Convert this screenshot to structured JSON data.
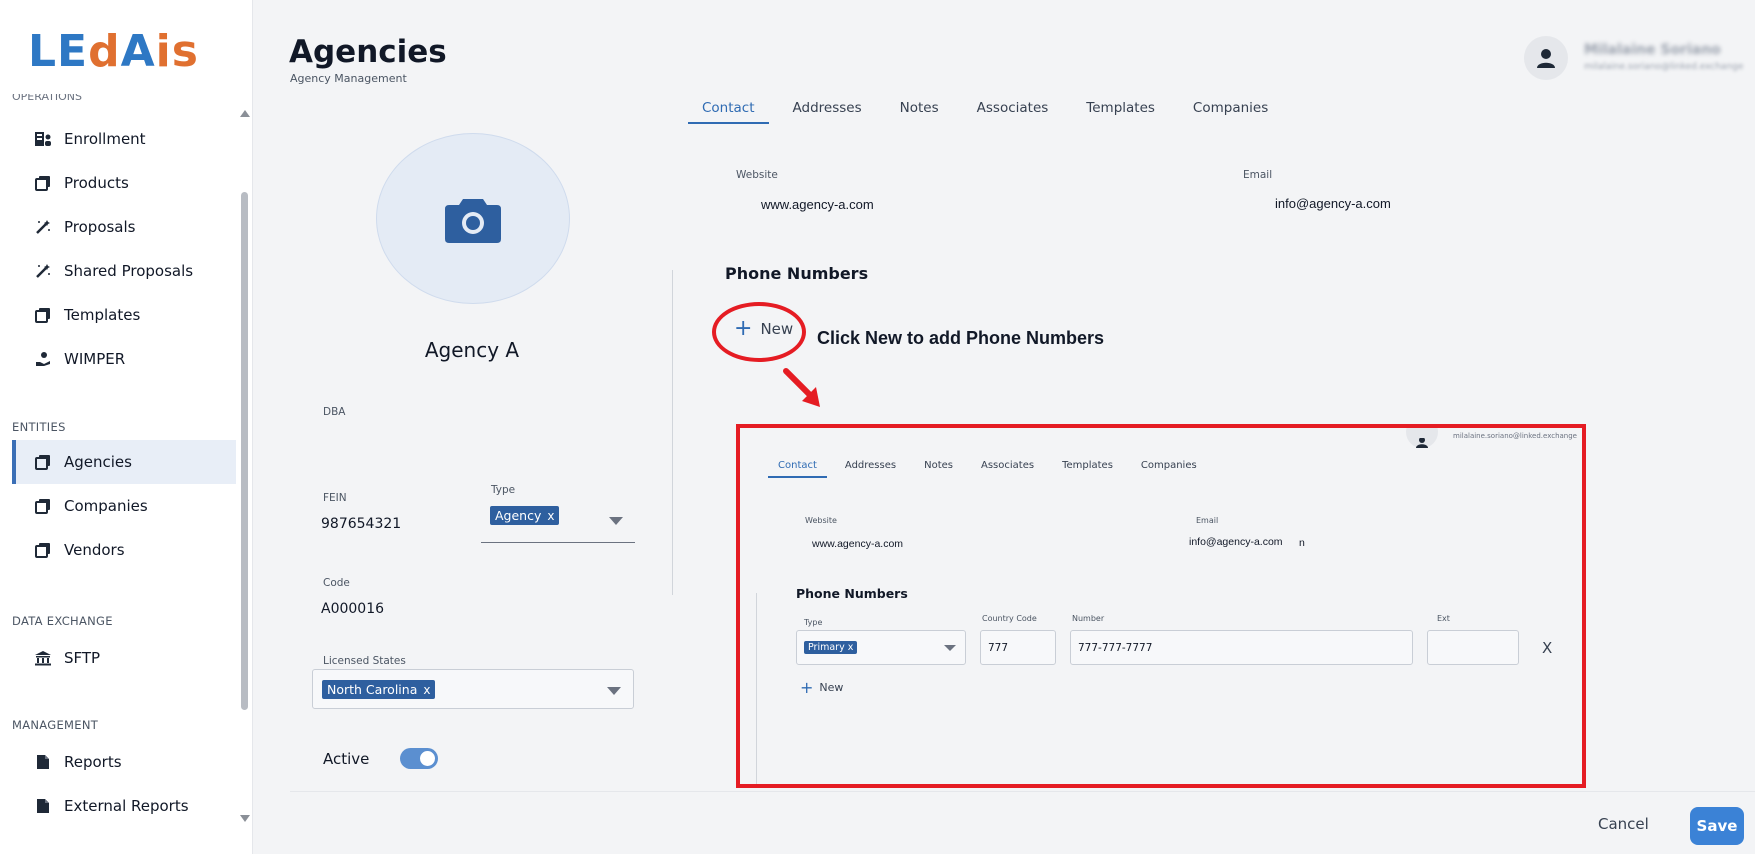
{
  "app": {
    "logo": "LEdAis"
  },
  "sidebar": {
    "cut_section": "OPERATIONS",
    "items": [
      {
        "label": "Enrollment",
        "icon": "enrollment-icon"
      },
      {
        "label": "Products",
        "icon": "stack-icon"
      },
      {
        "label": "Proposals",
        "icon": "magic-wand-icon"
      },
      {
        "label": "Shared Proposals",
        "icon": "magic-wand-icon"
      },
      {
        "label": "Templates",
        "icon": "stack-icon"
      },
      {
        "label": "WIMPER",
        "icon": "hand-coin-icon"
      }
    ],
    "entities_label": "ENTITIES",
    "entities": [
      {
        "label": "Agencies",
        "icon": "stack-icon",
        "active": true
      },
      {
        "label": "Companies",
        "icon": "stack-icon"
      },
      {
        "label": "Vendors",
        "icon": "stack-icon"
      }
    ],
    "data_exchange_label": "DATA EXCHANGE",
    "data_exchange": [
      {
        "label": "SFTP",
        "icon": "bank-icon"
      }
    ],
    "management_label": "MANAGEMENT",
    "management": [
      {
        "label": "Reports",
        "icon": "document-icon"
      },
      {
        "label": "External Reports",
        "icon": "document-icon"
      }
    ]
  },
  "header": {
    "title": "Agencies",
    "subtitle": "Agency Management",
    "user_name": "Milalaine Soriano",
    "user_email": "milalaine.soriano@linked.exchange"
  },
  "tabs": [
    "Contact",
    "Addresses",
    "Notes",
    "Associates",
    "Templates",
    "Companies"
  ],
  "active_tab": "Contact",
  "form": {
    "agency_name": "Agency A",
    "dba_label": "DBA",
    "dba_value": "",
    "fein_label": "FEIN",
    "fein_value": "987654321",
    "type_label": "Type",
    "type_chip": "Agency",
    "code_label": "Code",
    "code_value": "A000016",
    "licensed_states_label": "Licensed States",
    "licensed_states_chip": "North Carolina",
    "active_label": "Active",
    "active": true,
    "chip_remove": "x"
  },
  "contact": {
    "website_label": "Website",
    "website_value": "www.agency-a.com",
    "email_label": "Email",
    "email_value": "info@agency-a.com",
    "phone_numbers_title": "Phone Numbers",
    "new_label": "New"
  },
  "annotation": {
    "text": "Click New to add Phone Numbers",
    "color": "#e51c23"
  },
  "inset": {
    "email": "milalaine.soriano@linked.exchange",
    "tabs": [
      "Contact",
      "Addresses",
      "Notes",
      "Associates",
      "Templates",
      "Companies"
    ],
    "website_label": "Website",
    "website_value": "www.agency-a.com",
    "email_label": "Email",
    "email_value": "info@agency-a.com",
    "email_suffix": "n",
    "phone_numbers_title": "Phone Numbers",
    "type_label": "Type",
    "type_chip": "Primary",
    "country_code_label": "Country Code",
    "country_code_value": "777",
    "number_label": "Number",
    "number_value": "777-777-7777",
    "ext_label": "Ext",
    "ext_value": "",
    "close_label": "X",
    "new_label": "New"
  },
  "footer": {
    "cancel_label": "Cancel",
    "save_label": "Save"
  },
  "colors": {
    "accent": "#2f6bb3",
    "chip": "#2e5f9f",
    "save": "#3b82d6",
    "annotation": "#e51c23"
  }
}
